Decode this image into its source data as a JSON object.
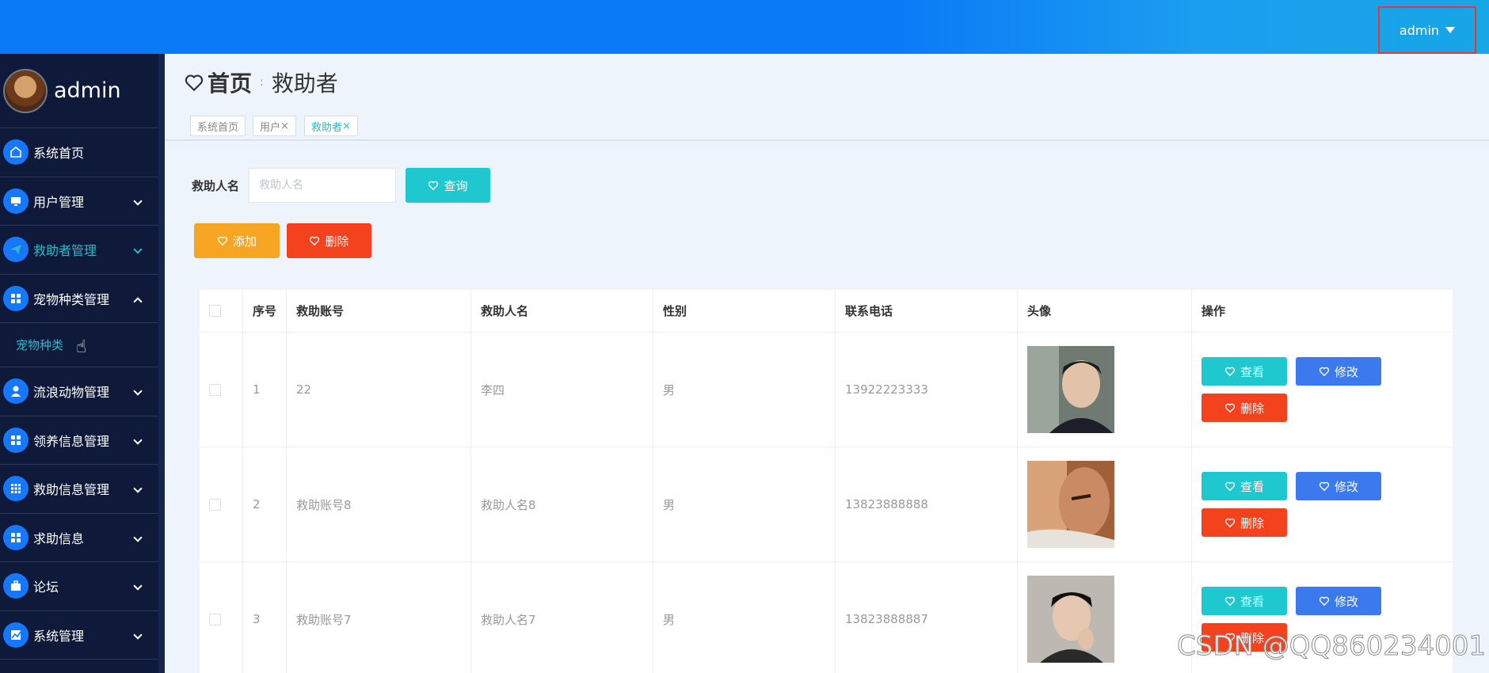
{
  "header": {
    "user": "admin"
  },
  "sidebar": {
    "profile_name": "admin",
    "items": [
      {
        "label": "系统首页",
        "icon": "home-icon"
      },
      {
        "label": "用户管理",
        "icon": "monitor-icon"
      },
      {
        "label": "救助者管理",
        "icon": "send-icon"
      },
      {
        "label": "宠物种类管理",
        "icon": "grid-icon"
      },
      {
        "label": "流浪动物管理",
        "icon": "user-icon"
      },
      {
        "label": "领养信息管理",
        "icon": "grid-icon"
      },
      {
        "label": "救助信息管理",
        "icon": "apps-icon"
      },
      {
        "label": "求助信息",
        "icon": "grid-icon"
      },
      {
        "label": "论坛",
        "icon": "briefcase-icon"
      },
      {
        "label": "系统管理",
        "icon": "chart-icon"
      }
    ],
    "submenu": "宠物种类"
  },
  "breadcrumb": {
    "home": "首页",
    "current": "救助者",
    "separator": ":"
  },
  "tags": [
    {
      "label": "系统首页",
      "closable": false
    },
    {
      "label": "用户",
      "closable": true
    },
    {
      "label": "救助者",
      "closable": true
    }
  ],
  "search": {
    "label": "救助人名",
    "placeholder": "救助人名",
    "query_button": "查询"
  },
  "actions": {
    "add": "添加",
    "delete": "删除"
  },
  "table": {
    "headers": [
      "序号",
      "救助账号",
      "救助人名",
      "性别",
      "联系电话",
      "头像",
      "操作"
    ],
    "rows": [
      {
        "no": "1",
        "account": "22",
        "name": "李四",
        "gender": "男",
        "phone": "13922223333"
      },
      {
        "no": "2",
        "account": "救助账号8",
        "name": "救助人名8",
        "gender": "男",
        "phone": "13823888888"
      },
      {
        "no": "3",
        "account": "救助账号7",
        "name": "救助人名7",
        "gender": "男",
        "phone": "13823888887"
      }
    ],
    "row_actions": {
      "view": "查看",
      "edit": "修改",
      "delete": "删除"
    }
  },
  "watermark": "CSDN @QQ860234001",
  "colors": {
    "topbar": "#0a7af6",
    "sidebar": "#0f1a3a",
    "teal": "#1fc8cf",
    "orange": "#f6a623",
    "red": "#f5421e",
    "blue": "#3b79ee"
  }
}
